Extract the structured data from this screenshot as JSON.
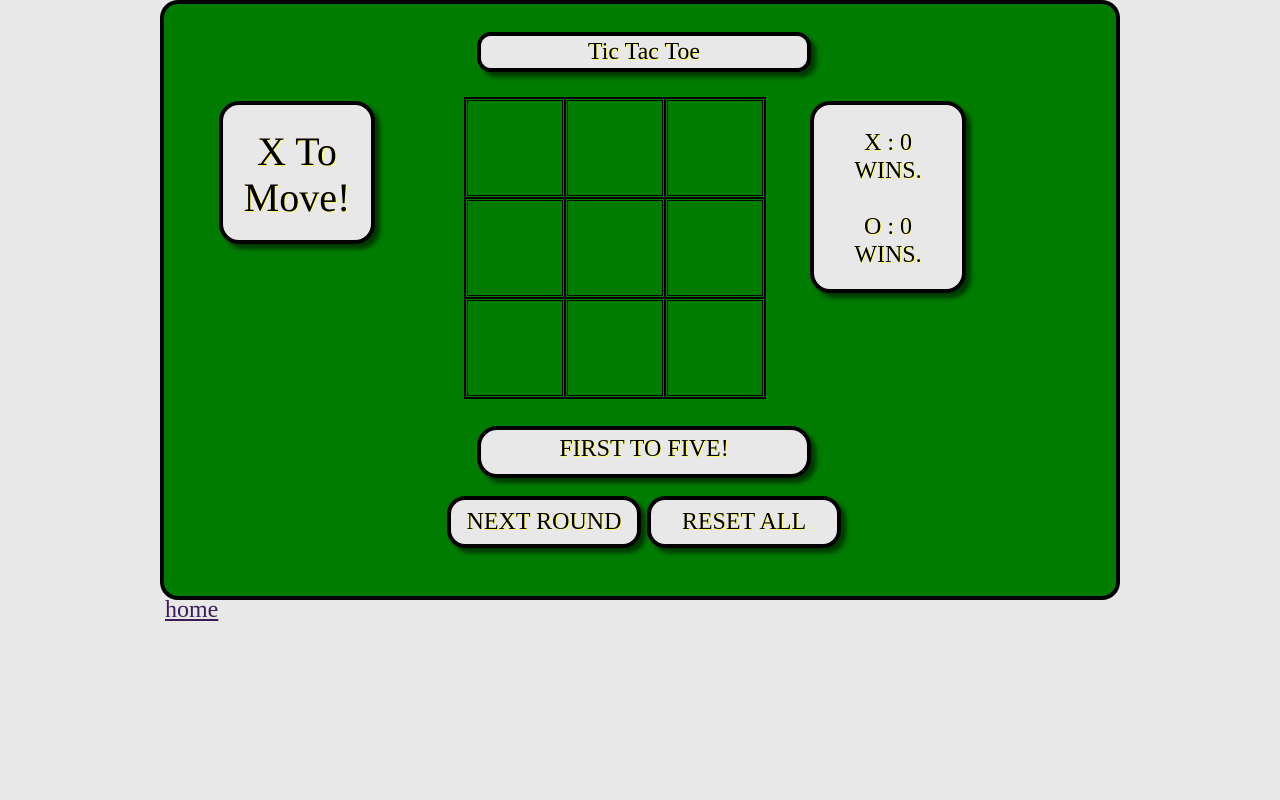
{
  "game": {
    "title": "Tic Tac Toe",
    "status_line1": "X To",
    "status_line2": "Move!",
    "score": {
      "x_line": "X : 0",
      "x_wins": "WINS.",
      "o_line": "O : 0",
      "o_wins": "WINS."
    },
    "goal": "FIRST TO FIVE!",
    "cells": [
      "",
      "",
      "",
      "",
      "",
      "",
      "",
      "",
      ""
    ],
    "next_round_label": "NEXT ROUND",
    "reset_all_label": "RESET ALL"
  },
  "footer": {
    "home_label": "home"
  },
  "colors": {
    "page_bg": "#e8e8e8",
    "board_bg": "#007c00",
    "border": "#000000",
    "text_glow": "#ffff66",
    "link": "#3b1d58"
  }
}
